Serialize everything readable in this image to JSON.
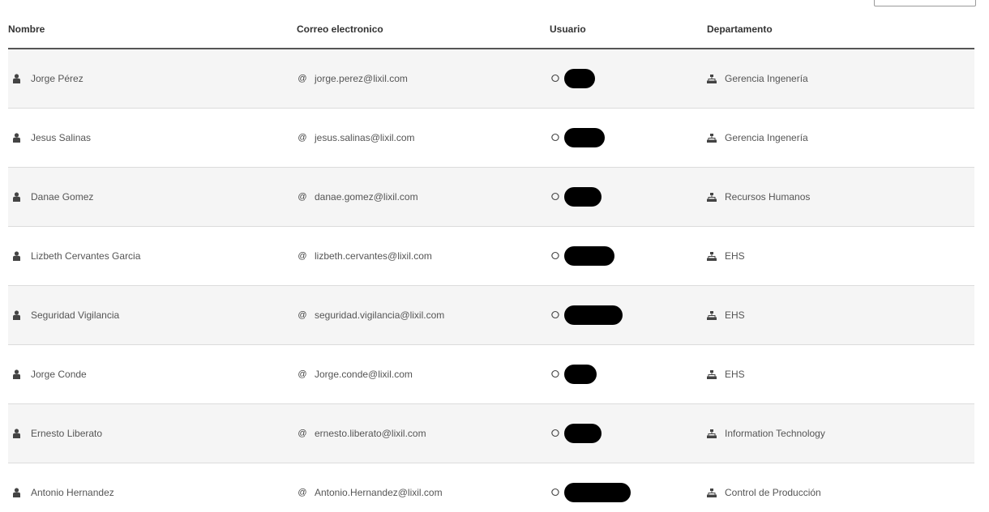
{
  "table": {
    "headers": {
      "name": "Nombre",
      "email": "Correo electronico",
      "user": "Usuario",
      "department": "Departamento"
    },
    "rows": [
      {
        "name": "Jorge Pérez",
        "email": "jorge.perez@lixil.com",
        "department": "Gerencia Ingenería"
      },
      {
        "name": "Jesus Salinas",
        "email": "jesus.salinas@lixil.com",
        "department": "Gerencia Ingenería"
      },
      {
        "name": "Danae Gomez",
        "email": "danae.gomez@lixil.com",
        "department": "Recursos Humanos"
      },
      {
        "name": "Lizbeth Cervantes Garcia",
        "email": "lizbeth.cervantes@lixil.com",
        "department": "EHS"
      },
      {
        "name": "Seguridad Vigilancia",
        "email": "seguridad.vigilancia@lixil.com",
        "department": "EHS"
      },
      {
        "name": "Jorge Conde",
        "email": "Jorge.conde@lixil.com",
        "department": "EHS"
      },
      {
        "name": "Ernesto Liberato",
        "email": "ernesto.liberato@lixil.com",
        "department": "Information Technology"
      },
      {
        "name": "Antonio Hernandez",
        "email": "Antonio.Hernandez@lixil.com",
        "department": "Control de Producción"
      }
    ]
  },
  "icons": {
    "name": "person-icon",
    "email": "at-sign-icon",
    "user": "user-circle-icon",
    "department": "sitemap-icon"
  },
  "colors": {
    "header_rule": "#555555",
    "stripe": "#f5f5f5",
    "row_rule": "#dcdcdc",
    "redaction": "#000000"
  }
}
